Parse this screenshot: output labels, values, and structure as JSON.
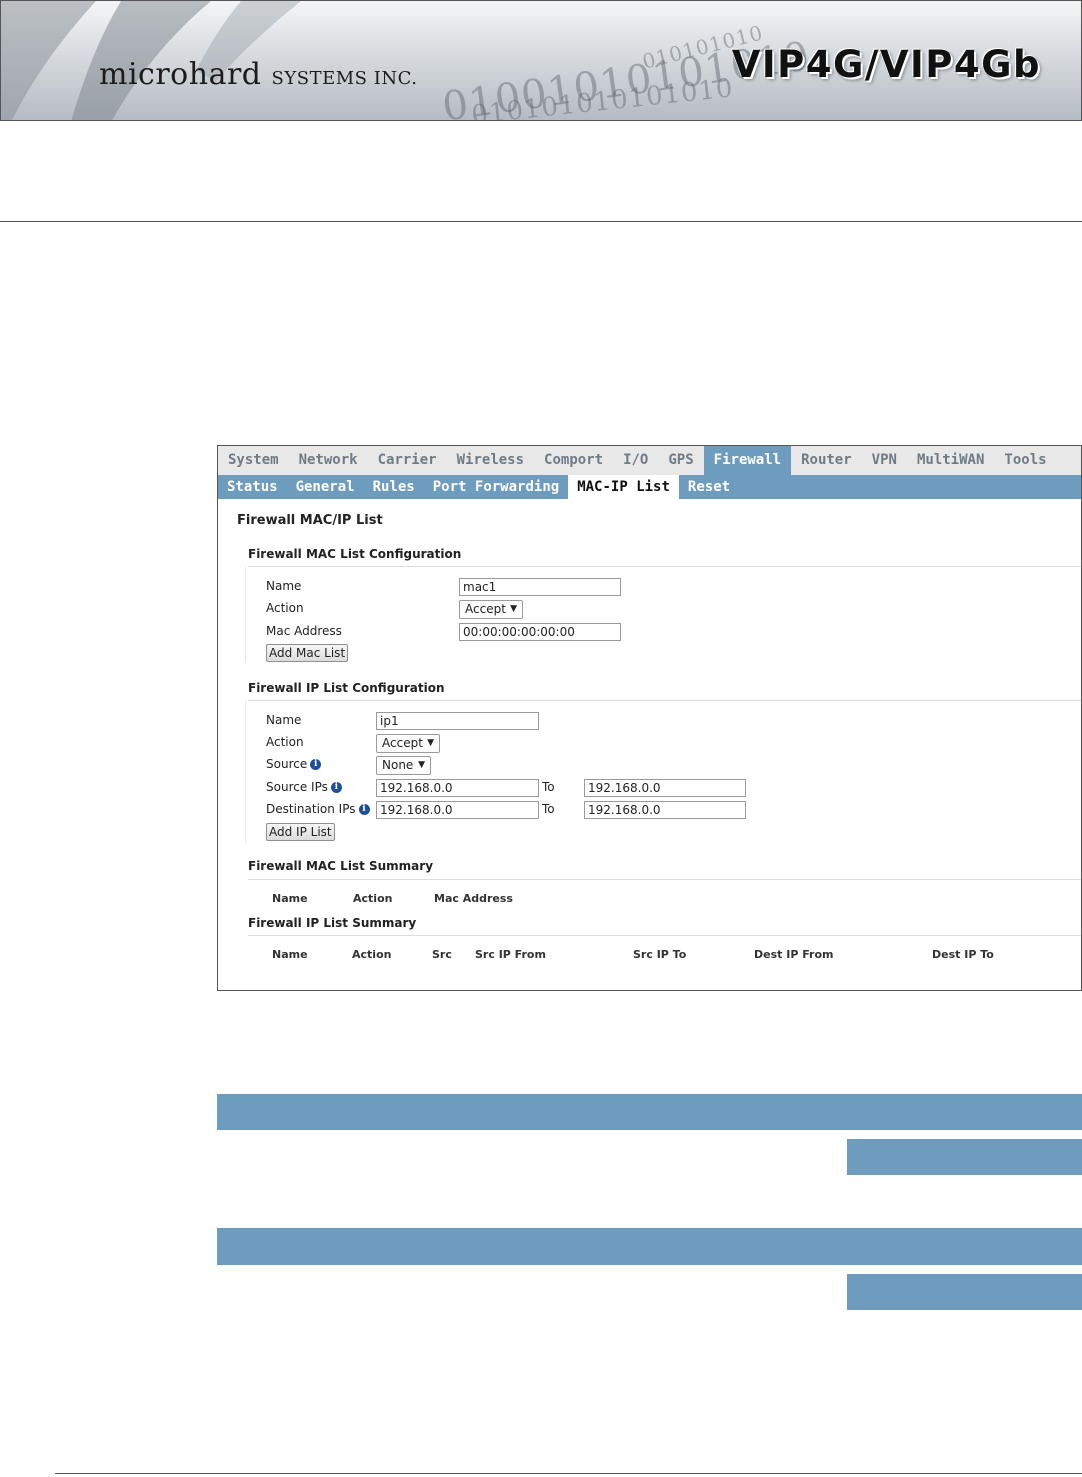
{
  "header": {
    "brand_name": "microhard",
    "brand_suffix": "SYSTEMS INC.",
    "product": "VIP4G/VIP4Gb",
    "binary_1": "01001010101010",
    "binary_2": "010101010101010",
    "binary_3": "010101010"
  },
  "nav": {
    "main": [
      "System",
      "Network",
      "Carrier",
      "Wireless",
      "Comport",
      "I/O",
      "GPS",
      "Firewall",
      "Router",
      "VPN",
      "MultiWAN",
      "Tools"
    ],
    "main_active": "Firewall",
    "sub": [
      "Status",
      "General",
      "Rules",
      "Port Forwarding",
      "MAC-IP List",
      "Reset"
    ],
    "sub_active": "MAC-IP List"
  },
  "page": {
    "title": "Firewall MAC/IP List"
  },
  "mac_config": {
    "heading": "Firewall MAC List Configuration",
    "name_label": "Name",
    "name_value": "mac1",
    "action_label": "Action",
    "action_value": "Accept",
    "mac_label": "Mac Address",
    "mac_value": "00:00:00:00:00:00",
    "add_button": "Add Mac List"
  },
  "ip_config": {
    "heading": "Firewall IP List Configuration",
    "name_label": "Name",
    "name_value": "ip1",
    "action_label": "Action",
    "action_value": "Accept",
    "source_label": "Source",
    "source_value": "None",
    "source_ips_label": "Source IPs",
    "source_ip_from": "192.168.0.0",
    "source_ip_to": "192.168.0.0",
    "dest_ips_label": "Destination IPs",
    "dest_ip_from": "192.168.0.0",
    "dest_ip_to": "192.168.0.0",
    "to_label": "To",
    "add_button": "Add IP List"
  },
  "mac_summary": {
    "heading": "Firewall MAC List Summary",
    "columns": [
      "Name",
      "Action",
      "Mac Address"
    ]
  },
  "ip_summary": {
    "heading": "Firewall IP List Summary",
    "columns": [
      "Name",
      "Action",
      "Src",
      "Src IP From",
      "Src IP To",
      "Dest IP From",
      "Dest IP To"
    ]
  },
  "colors": {
    "accent_blue": "#6e9cbf",
    "info_icon": "#1f4e9a"
  }
}
